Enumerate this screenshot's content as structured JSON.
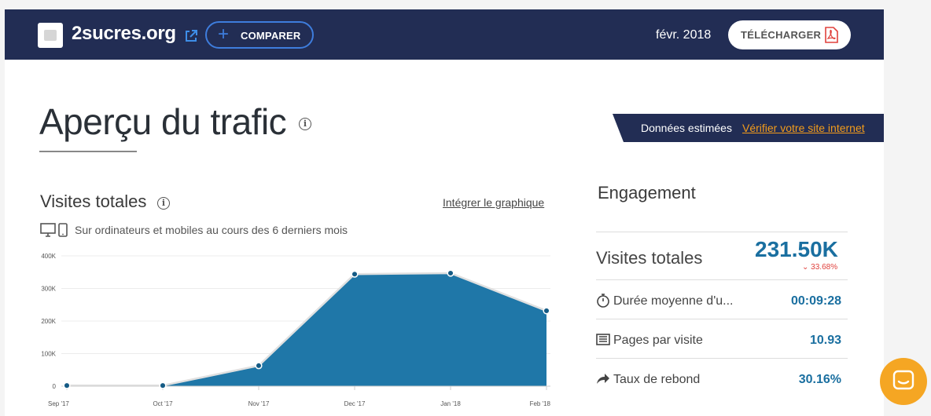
{
  "header": {
    "site_name": "2sucres.org",
    "compare_label": "COMPARER",
    "date": "févr. 2018",
    "download_label": "TÉLÉCHARGER"
  },
  "page": {
    "title": "Aperçu du trafic",
    "estimate_label": "Données estimées",
    "verify_link": "Vérifier votre site internet"
  },
  "visits": {
    "title": "Visites totales",
    "embed_link": "Intégrer le graphique",
    "device_text": "Sur ordinateurs et mobiles au cours des 6 derniers mois"
  },
  "chart_data": {
    "type": "area",
    "categories": [
      "Sep '17",
      "Oct '17",
      "Nov '17",
      "Dec '17",
      "Jan '18",
      "Feb '18"
    ],
    "values": [
      2000,
      2000,
      63000,
      344000,
      347000,
      231500
    ],
    "y_ticks": [
      "0",
      "100K",
      "200K",
      "300K",
      "400K"
    ],
    "ylim": [
      0,
      400000
    ],
    "grid": true,
    "colors": {
      "fill": "#1f77a8",
      "line": "#e0e0e0",
      "point": "#155b85"
    }
  },
  "engagement": {
    "title": "Engagement",
    "main_label": "Visites totales",
    "main_value": "231.50K",
    "main_change": "33.68%",
    "rows": [
      {
        "icon": "stopwatch-icon",
        "label": "Durée moyenne d'u...",
        "value": "00:09:28"
      },
      {
        "icon": "pages-icon",
        "label": "Pages par visite",
        "value": "10.93"
      },
      {
        "icon": "bounce-arrow-icon",
        "label": "Taux de rebond",
        "value": "30.16%"
      }
    ]
  },
  "colors": {
    "header_bg": "#222d54",
    "accent_blue": "#1a6fa0",
    "link_orange": "#f39c1b",
    "chat_orange": "#f5a623",
    "negative_red": "#e0413c"
  }
}
